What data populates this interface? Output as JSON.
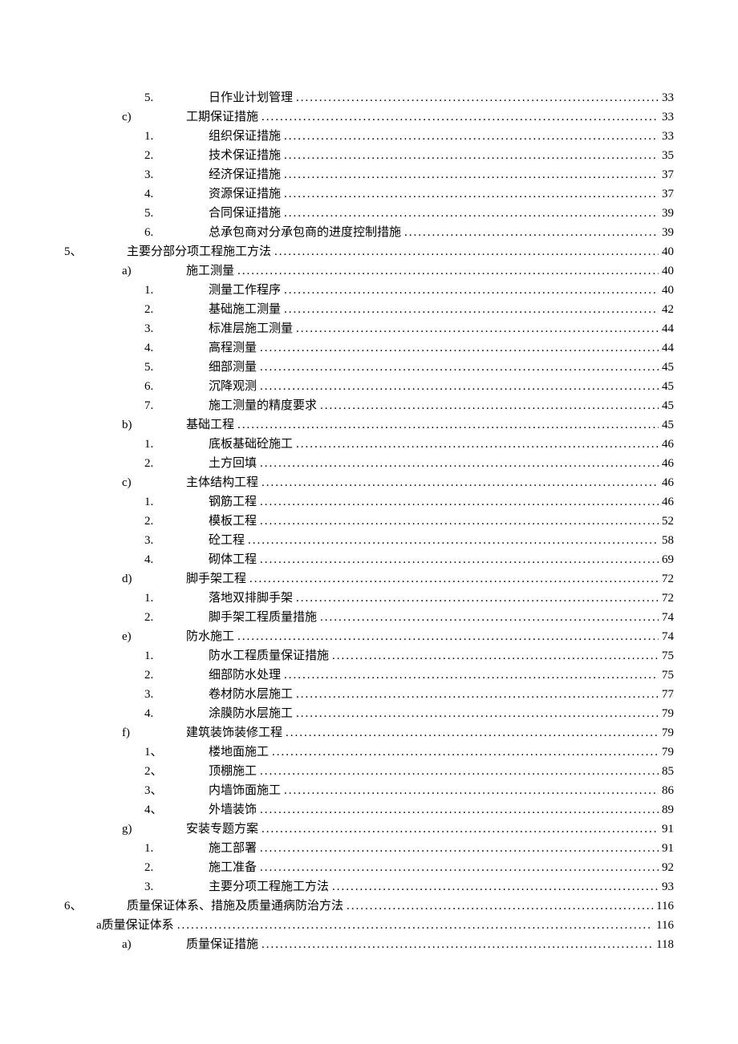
{
  "entries": [
    {
      "level": 4,
      "marker": "5.",
      "title": "日作业计划管理",
      "page": "33"
    },
    {
      "level": 3,
      "marker": "c)",
      "title": "工期保证措施",
      "page": "33"
    },
    {
      "level": 4,
      "marker": "1.",
      "title": "组织保证措施",
      "page": "33"
    },
    {
      "level": 4,
      "marker": "2.",
      "title": "技术保证措施",
      "page": "35"
    },
    {
      "level": 4,
      "marker": "3.",
      "title": "经济保证措施",
      "page": "37"
    },
    {
      "level": 4,
      "marker": "4.",
      "title": "资源保证措施",
      "page": "37"
    },
    {
      "level": 4,
      "marker": "5.",
      "title": "合同保证措施",
      "page": "39"
    },
    {
      "level": 4,
      "marker": "6.",
      "title": "总承包商对分承包商的进度控制措施",
      "page": "39"
    },
    {
      "level": 1,
      "marker": "5、",
      "markerCN": true,
      "title": "主要分部分项工程施工方法",
      "page": "40"
    },
    {
      "level": 3,
      "marker": "a)",
      "title": "施工测量",
      "page": "40"
    },
    {
      "level": 4,
      "marker": "1.",
      "title": "测量工作程序",
      "page": "40"
    },
    {
      "level": 4,
      "marker": "2.",
      "title": "基础施工测量",
      "page": "42"
    },
    {
      "level": 4,
      "marker": "3.",
      "title": "标准层施工测量",
      "page": "44"
    },
    {
      "level": 4,
      "marker": "4.",
      "title": "高程测量",
      "page": "44"
    },
    {
      "level": 4,
      "marker": "5.",
      "title": "细部测量",
      "page": "45"
    },
    {
      "level": 4,
      "marker": "6.",
      "title": "沉降观测",
      "page": "45"
    },
    {
      "level": 4,
      "marker": "7.",
      "title": "施工测量的精度要求",
      "page": "45"
    },
    {
      "level": 3,
      "marker": "b)",
      "title": "基础工程",
      "page": "45"
    },
    {
      "level": 4,
      "marker": "1.",
      "title": "底板基础砼施工",
      "page": "46"
    },
    {
      "level": 4,
      "marker": "2.",
      "title": "土方回填",
      "page": "46"
    },
    {
      "level": 3,
      "marker": "c)",
      "title": "主体结构工程",
      "page": "46"
    },
    {
      "level": 4,
      "marker": "1.",
      "title": "钢筋工程",
      "page": "46"
    },
    {
      "level": 4,
      "marker": "2.",
      "title": "模板工程",
      "page": "52"
    },
    {
      "level": 4,
      "marker": "3.",
      "title": "砼工程",
      "page": "58"
    },
    {
      "level": 4,
      "marker": "4.",
      "title": "砌体工程",
      "page": "69"
    },
    {
      "level": 3,
      "marker": "d)",
      "title": "脚手架工程",
      "page": "72"
    },
    {
      "level": 4,
      "marker": "1.",
      "title": "落地双排脚手架",
      "page": "72"
    },
    {
      "level": 4,
      "marker": "2.",
      "title": "脚手架工程质量措施",
      "page": "74"
    },
    {
      "level": 3,
      "marker": "e)",
      "title": "防水施工",
      "page": "74"
    },
    {
      "level": 4,
      "marker": "1.",
      "title": "防水工程质量保证措施",
      "page": "75"
    },
    {
      "level": 4,
      "marker": "2.",
      "title": "细部防水处理",
      "page": "75"
    },
    {
      "level": 4,
      "marker": "3.",
      "title": "卷材防水层施工",
      "page": "77"
    },
    {
      "level": 4,
      "marker": "4.",
      "title": "涂膜防水层施工",
      "page": "79"
    },
    {
      "level": 3,
      "marker": "f)",
      "title": "建筑装饰装修工程",
      "page": "79"
    },
    {
      "level": 4,
      "marker": "1、",
      "markerCN": true,
      "title": "楼地面施工",
      "page": "79"
    },
    {
      "level": 4,
      "marker": "2、",
      "markerCN": true,
      "title": "顶棚施工",
      "page": "85"
    },
    {
      "level": 4,
      "marker": "3、",
      "markerCN": true,
      "title": "内墙饰面施工",
      "page": "86"
    },
    {
      "level": 4,
      "marker": "4、",
      "markerCN": true,
      "title": "外墙装饰",
      "page": "89"
    },
    {
      "level": 3,
      "marker": "g)",
      "title": "安装专题方案",
      "page": "91"
    },
    {
      "level": 4,
      "marker": "1.",
      "title": "施工部署",
      "page": "91"
    },
    {
      "level": 4,
      "marker": "2.",
      "title": "施工准备",
      "page": "92"
    },
    {
      "level": 4,
      "marker": "3.",
      "title": "主要分项工程施工方法",
      "page": "93"
    },
    {
      "level": 1,
      "marker": "6、",
      "markerCN": true,
      "title": "质量保证体系、措施及质量通病防治方法",
      "page": "116"
    },
    {
      "level": 2,
      "marker": "a",
      "title": "质量保证体系",
      "page": "116"
    },
    {
      "level": 3,
      "marker": "a)",
      "title": "质量保证措施",
      "page": "118"
    }
  ]
}
